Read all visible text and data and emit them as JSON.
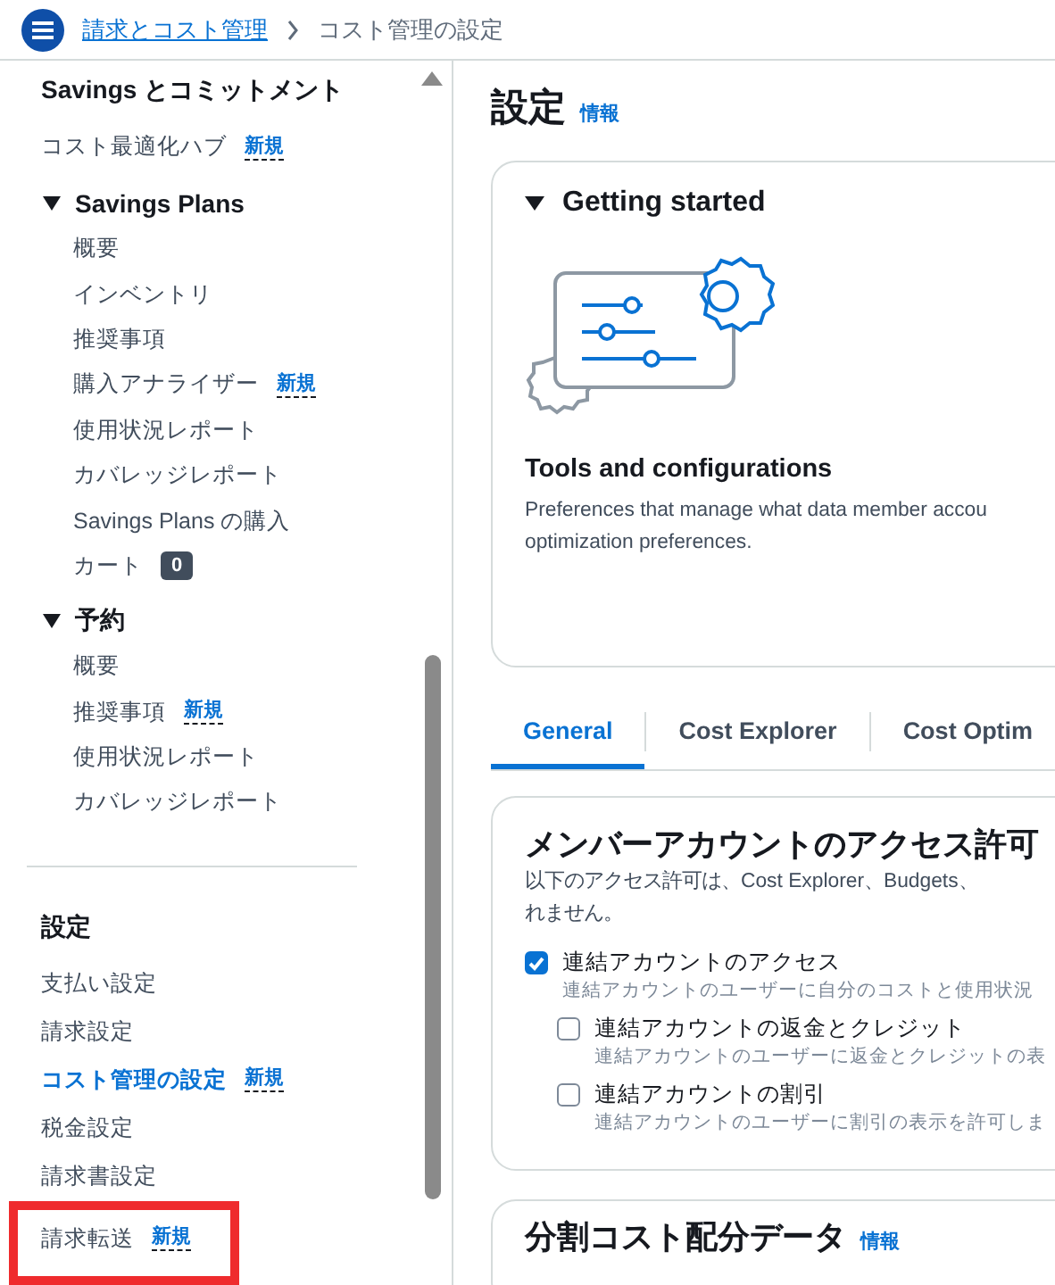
{
  "header": {
    "breadcrumb": [
      {
        "label": "請求とコスト管理",
        "kind": "link"
      },
      {
        "label": "コスト管理の設定",
        "kind": "current"
      }
    ]
  },
  "sidebar": {
    "entries": [
      {
        "kind": "heading",
        "label": "Savings とコミットメント"
      },
      {
        "kind": "link",
        "label": "コスト最適化ハブ",
        "badge": "新規",
        "selected": false,
        "highlighted": false
      },
      {
        "kind": "group",
        "label": "Savings Plans",
        "expanded": true,
        "children": [
          {
            "label": "概要",
            "selected": false
          },
          {
            "label": "インベントリ",
            "selected": false
          },
          {
            "label": "推奨事項",
            "selected": false
          },
          {
            "label": "購入アナライザー",
            "badge": "新規",
            "selected": false
          },
          {
            "label": "使用状況レポート",
            "selected": false
          },
          {
            "label": "カバレッジレポート",
            "selected": false
          },
          {
            "label": "Savings Plans の購入",
            "selected": false
          },
          {
            "label": "カート",
            "count": "0",
            "selected": false
          }
        ]
      },
      {
        "kind": "group",
        "label": "予約",
        "expanded": true,
        "children": [
          {
            "label": "概要",
            "selected": false
          },
          {
            "label": "推奨事項",
            "badge": "新規",
            "selected": false
          },
          {
            "label": "使用状況レポート",
            "selected": false
          },
          {
            "label": "カバレッジレポート",
            "selected": false
          }
        ]
      },
      {
        "kind": "divider"
      },
      {
        "kind": "heading",
        "label": "設定"
      },
      {
        "kind": "link",
        "label": "支払い設定",
        "selected": false,
        "highlighted": false
      },
      {
        "kind": "link",
        "label": "請求設定",
        "selected": false,
        "highlighted": false
      },
      {
        "kind": "link",
        "label": "コスト管理の設定",
        "badge": "新規",
        "selected": true,
        "highlighted": false
      },
      {
        "kind": "link",
        "label": "税金設定",
        "selected": false,
        "highlighted": false
      },
      {
        "kind": "link",
        "label": "請求書設定",
        "selected": false,
        "highlighted": false
      },
      {
        "kind": "link",
        "label": "請求転送",
        "badge": "新規",
        "selected": false,
        "highlighted": true
      }
    ]
  },
  "main": {
    "title": "設定",
    "info_link": "情報",
    "getting_started": {
      "title": "Getting started",
      "expanded": true,
      "heading": "Tools and configurations",
      "description_lines": [
        "Preferences that manage what data member accou",
        "optimization preferences."
      ]
    },
    "tabs": [
      {
        "label": "General",
        "selected": true
      },
      {
        "label": "Cost Explorer",
        "selected": false
      },
      {
        "label": "Cost Optim",
        "selected": false
      }
    ],
    "permissions": {
      "title": "メンバーアカウントのアクセス許可",
      "description_lines": [
        "以下のアクセス許可は、Cost Explorer、Budgets、",
        "れません。"
      ],
      "checkboxes": [
        {
          "label": "連結アカウントのアクセス",
          "description": "連結アカウントのユーザーに自分のコストと使用状況",
          "checked": true,
          "children": [
            {
              "label": "連結アカウントの返金とクレジット",
              "description": "連結アカウントのユーザーに返金とクレジットの表",
              "checked": false
            },
            {
              "label": "連結アカウントの割引",
              "description": "連結アカウントのユーザーに割引の表示を許可しま",
              "checked": false
            }
          ]
        }
      ]
    },
    "split_cost": {
      "title": "分割コスト配分データ",
      "info_link": "情報"
    }
  }
}
